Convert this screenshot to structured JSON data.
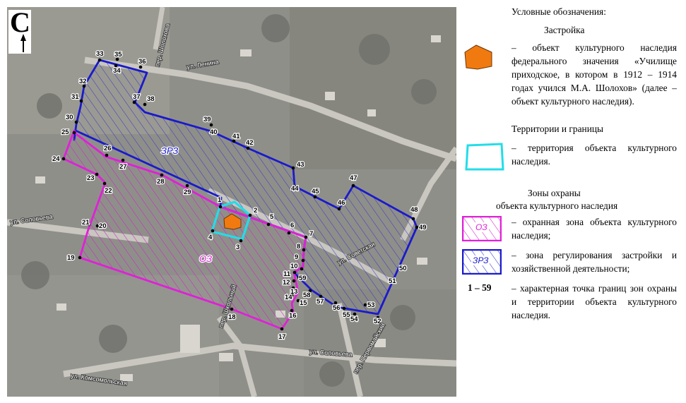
{
  "north": {
    "letter": "С",
    "icon": "north-arrow-icon"
  },
  "map": {
    "streets": [
      {
        "id": "lenina",
        "label": "ул. Ленина"
      },
      {
        "id": "sholokhova",
        "label": "пер. Шолохова"
      },
      {
        "id": "solovyeva_w",
        "label": "ул. Соловьева"
      },
      {
        "id": "sovetskaya",
        "label": "ул. Советская"
      },
      {
        "id": "shkolny",
        "label": "пер. Школьный"
      },
      {
        "id": "solovyeva_s",
        "label": "ул. Соловьева"
      },
      {
        "id": "pervomaisky",
        "label": "пер. Первомайский"
      },
      {
        "id": "komsomolskaya",
        "label": "ул. Комсомольская"
      }
    ],
    "zone_labels": {
      "zrz": "ЗРЗ",
      "oz": "ОЗ"
    },
    "points": [
      "1",
      "2",
      "3",
      "4",
      "5",
      "6",
      "7",
      "8",
      "9",
      "10",
      "11",
      "12",
      "13",
      "14",
      "15",
      "16",
      "17",
      "18",
      "19",
      "20",
      "21",
      "22",
      "23",
      "24",
      "25",
      "26",
      "27",
      "28",
      "29",
      "30",
      "31",
      "32",
      "33",
      "34",
      "35",
      "36",
      "37",
      "38",
      "39",
      "40",
      "41",
      "42",
      "43",
      "44",
      "45",
      "46",
      "47",
      "48",
      "49",
      "50",
      "51",
      "52",
      "53",
      "54",
      "55",
      "56",
      "57",
      "58",
      "59"
    ]
  },
  "legend": {
    "title": "Условные обозначения:",
    "section_building": "Застройка",
    "building_desc": "– объект культурного наследия федерального значения «Училище приходское, в котором в 1912 – 1914 годах учился М.А. Шолохов» (далее – объект культурного наследия).",
    "section_territories": "Территории и границы",
    "territory_desc": "– территория объекта культурного наследия.",
    "section_zones_line1": "Зоны охраны",
    "section_zones_line2": "объекта культурного наследия",
    "oz_swatch_label": "ОЗ",
    "oz_desc": "– охранная зона объекта культурного наследия;",
    "zrz_swatch_label": "ЗРЗ",
    "zrz_desc": "– зона регулирования застройки и хозяйственной деятельности;",
    "range_label": "1 – 59",
    "range_desc": "– характерная точка границ зон охраны и территории объекта культурного наследия."
  },
  "colors": {
    "oz": "#e020d8",
    "zrz": "#1a1acc",
    "territory": "#22dde8",
    "building": "#f07a10"
  }
}
